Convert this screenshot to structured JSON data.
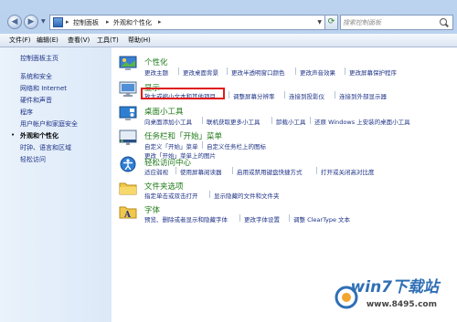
{
  "address_bar": {
    "crumbs": [
      "控制面板",
      "外观和个性化"
    ],
    "separator": "▸"
  },
  "search": {
    "placeholder": "搜索控制面板"
  },
  "menu": [
    "文件(F)",
    "编辑(E)",
    "查看(V)",
    "工具(T)",
    "帮助(H)"
  ],
  "sidebar": {
    "items": [
      {
        "label": "控制面板主页"
      },
      {
        "label": "系统和安全"
      },
      {
        "label": "网络和 Internet"
      },
      {
        "label": "硬件和声音"
      },
      {
        "label": "程序"
      },
      {
        "label": "用户帐户和家庭安全"
      },
      {
        "label": "外观和个性化",
        "current": true,
        "bullet": "•"
      },
      {
        "label": "时钟、语言和区域"
      },
      {
        "label": "轻松访问"
      }
    ]
  },
  "categories": [
    {
      "title": "个性化",
      "icon": "personalization-icon",
      "links": [
        [
          "更改主题",
          "更改桌面背景",
          "更改半透明窗口颜色",
          "更改声音效果",
          "更改屏幕保护程序"
        ]
      ]
    },
    {
      "title": "显示",
      "icon": "display-icon",
      "links": [
        [
          "放大或缩小文本和其他项目",
          "调整屏幕分辨率",
          "连接到投影仪",
          "连接到外部显示器"
        ]
      ]
    },
    {
      "title": "桌面小工具",
      "icon": "desktop-gadgets-icon",
      "links": [
        [
          "向桌面添加小工具",
          "联机获取更多小工具",
          "卸载小工具",
          "还原 Windows 上安装的桌面小工具"
        ]
      ]
    },
    {
      "title": "任务栏和「开始」菜单",
      "icon": "taskbar-icon",
      "links": [
        [
          "自定义「开始」菜单",
          "自定义任务栏上的图标"
        ],
        [
          "更改「开始」菜单上的图片"
        ]
      ]
    },
    {
      "title": "轻松访问中心",
      "icon": "ease-of-access-icon",
      "links": [
        [
          "适应弱视",
          "使用屏幕阅读器",
          "启用或禁用键盘快捷方式",
          "打开或关闭高对比度"
        ]
      ]
    },
    {
      "title": "文件夹选项",
      "icon": "folder-options-icon",
      "links": [
        [
          "指定单击或双击打开",
          "显示隐藏的文件和文件夹"
        ]
      ]
    },
    {
      "title": "字体",
      "icon": "fonts-icon",
      "links": [
        [
          "预览、删除或者显示和隐藏字体",
          "更改字体设置",
          "调整 ClearType 文本"
        ]
      ]
    }
  ],
  "watermark": {
    "brand": "win7下载站",
    "url": "www.8495.com"
  }
}
